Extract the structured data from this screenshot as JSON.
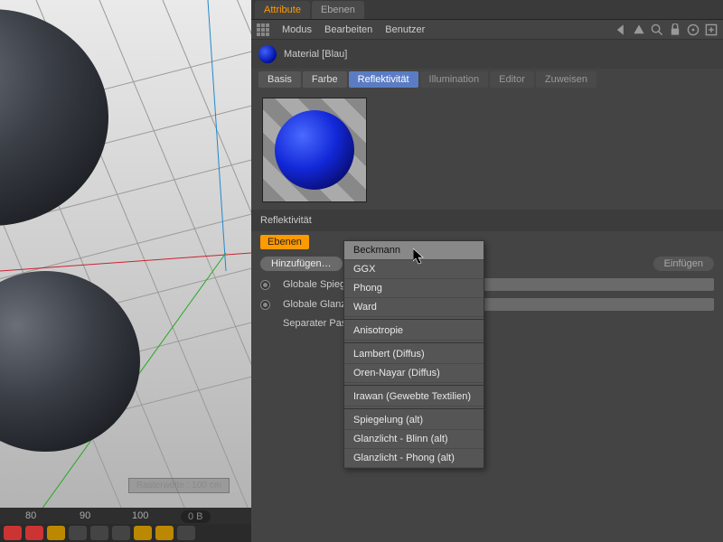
{
  "panel_tabs": {
    "attribute": "Attribute",
    "ebenen": "Ebenen"
  },
  "menubar": {
    "modus": "Modus",
    "bearbeiten": "Bearbeiten",
    "benutzer": "Benutzer"
  },
  "material_name": "Material [Blau]",
  "sub_tabs": {
    "basis": "Basis",
    "farbe": "Farbe",
    "reflekt": "Reflektivität",
    "illum": "Illumination",
    "editor": "Editor",
    "zuweisen": "Zuweisen"
  },
  "section_title": "Reflektivität",
  "ebenen_chip": "Ebenen",
  "buttons": {
    "hinzufuegen": "Hinzufügen…",
    "einfuegen": "Einfügen"
  },
  "rows": {
    "globale_spiegel": "Globale Spiege",
    "globale_glanz": "Globale Glanzl",
    "separater": "Separater Pass"
  },
  "dropdown": {
    "items": [
      "Beckmann",
      "GGX",
      "Phong",
      "Ward",
      "__sep__",
      "Anisotropie",
      "__sep__",
      "Lambert (Diffus)",
      "Oren-Nayar (Diffus)",
      "__sep__",
      "Irawan (Gewebte Textilien)",
      "__sep__",
      "Spiegelung (alt)",
      "Glanzlicht - Blinn (alt)",
      "Glanzlicht - Phong (alt)"
    ],
    "highlighted": "Beckmann"
  },
  "ruler": {
    "t80": "80",
    "t90": "90",
    "t100": "100"
  },
  "status": "0 B",
  "viewport_label": "Rasterweite : 100 cm"
}
